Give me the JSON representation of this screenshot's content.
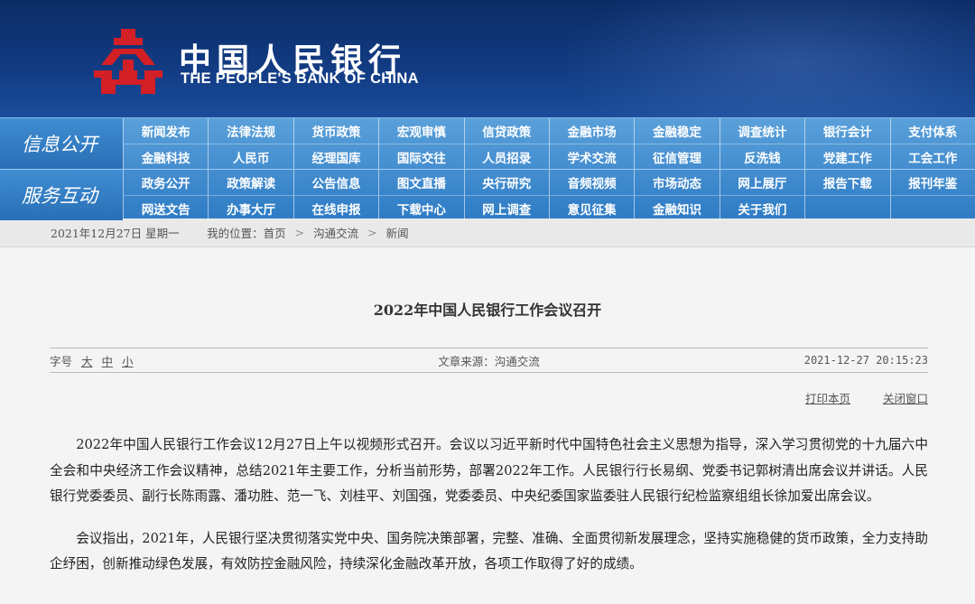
{
  "header": {
    "cn_name": "中国人民银行",
    "en_name": "THE PEOPLE'S BANK OF CHINA",
    "logo_icon": "pboc-emblem-icon",
    "logo_color": "#d31f26"
  },
  "nav": {
    "group1_label": "信息公开",
    "group1_items": [
      "新闻发布",
      "法律法规",
      "货币政策",
      "宏观审慎",
      "信贷政策",
      "金融市场",
      "金融稳定",
      "调查统计",
      "银行会计",
      "支付体系",
      "金融科技",
      "人民币",
      "经理国库",
      "国际交往",
      "人员招录",
      "学术交流",
      "征信管理",
      "反洗钱",
      "党建工作",
      "工会工作"
    ],
    "group2_label": "服务互动",
    "group2_items": [
      "政务公开",
      "政策解读",
      "公告信息",
      "图文直播",
      "央行研究",
      "音频视频",
      "市场动态",
      "网上展厅",
      "报告下载",
      "报刊年鉴",
      "网送文告",
      "办事大厅",
      "在线申报",
      "下载中心",
      "网上调查",
      "意见征集",
      "金融知识",
      "关于我们",
      "",
      ""
    ]
  },
  "crumb": {
    "date": "2021年12月27日  星期一",
    "location_prefix": "我的位置：首页",
    "level1": "沟通交流",
    "level2": "新闻",
    "separator": ">"
  },
  "article": {
    "title": "2022年中国人民银行工作会议召开",
    "font_size_label": "字号",
    "font_large": "大",
    "font_medium": "中",
    "font_small": "小",
    "source": "文章来源：沟通交流",
    "datetime": "2021-12-27  20:15:23",
    "print_label": "打印本页",
    "close_label": "关闭窗口",
    "paragraphs": [
      "2022年中国人民银行工作会议12月27日上午以视频形式召开。会议以习近平新时代中国特色社会主义思想为指导，深入学习贯彻党的十九届六中全会和中央经济工作会议精神，总结2021年主要工作，分析当前形势，部署2022年工作。人民银行行长易纲、党委书记郭树清出席会议并讲话。人民银行党委委员、副行长陈雨露、潘功胜、范一飞、刘桂平、刘国强，党委委员、中央纪委国家监委驻人民银行纪检监察组组长徐加爱出席会议。",
      "会议指出，2021年，人民银行坚决贯彻落实党中央、国务院决策部署，完整、准确、全面贯彻新发展理念，坚持实施稳健的货币政策，全力支持助企纾困，创新推动绿色发展，有效防控金融风险，持续深化金融改革开放，各项工作取得了好的成绩。"
    ]
  }
}
